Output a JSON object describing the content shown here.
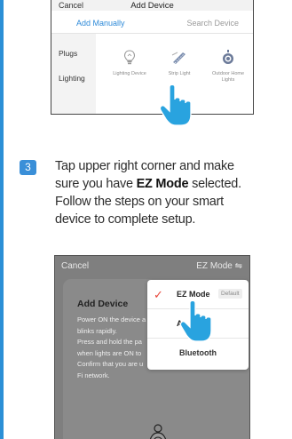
{
  "top_screenshot": {
    "cancel_label": "Cancel",
    "title": "Add Device",
    "tabs": [
      "Add Manually",
      "Search Device"
    ],
    "sidebar": [
      "Plugs",
      "Lighting"
    ],
    "devices": [
      {
        "label": "Lighting Device",
        "icon": "bulb-icon"
      },
      {
        "label": "Strip Light",
        "icon": "strip-light-icon"
      },
      {
        "label": "Outdoor Home Lights",
        "icon": "outdoor-light-icon"
      }
    ]
  },
  "step": {
    "number": "3",
    "line1": "Tap upper right corner and make",
    "line2_pre": "sure you have ",
    "line2_bold": "EZ Mode",
    "line2_post": " selected.",
    "line3": "Follow the steps on your smart",
    "line4": "device to complete setup."
  },
  "bottom_screenshot": {
    "cancel_label": "Cancel",
    "mode_label": "EZ Mode ⇋",
    "card_title": "Add Device",
    "card_lines": [
      "Power ON the device a",
      "blinks rapidly.",
      "Press and hold the pa",
      "when lights are ON to",
      "Confirm that you are u",
      "Fi network."
    ],
    "menu": {
      "ez_mode": "EZ Mode",
      "default_badge": "Default",
      "ap_mode": "A",
      "bluetooth": "Bluetooth"
    }
  },
  "colors": {
    "accent": "#2b8fd6",
    "hand": "#29a3df",
    "check": "#e8473b"
  }
}
